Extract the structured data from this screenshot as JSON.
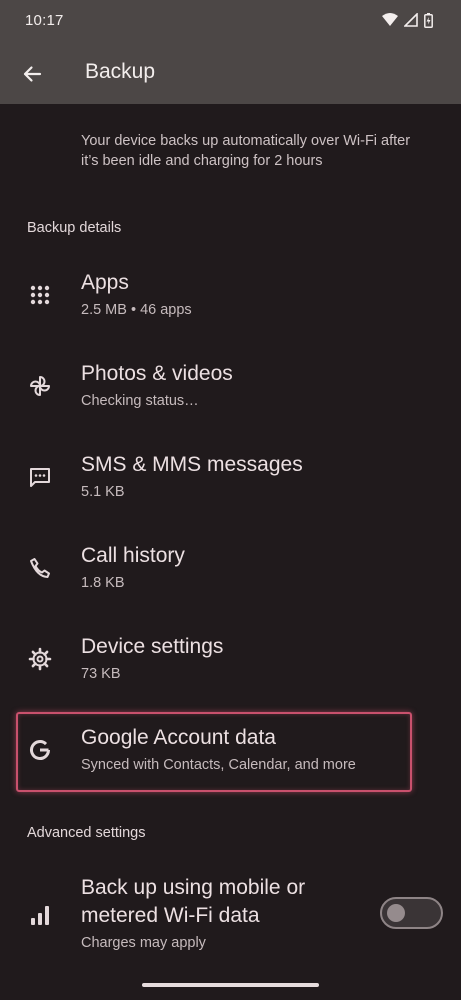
{
  "status_bar": {
    "time": "10:17"
  },
  "header": {
    "title": "Backup"
  },
  "intro_text": "Your device backs up automatically over Wi-Fi after it’s been idle and charging for 2 hours",
  "sections": {
    "backup_details": "Backup details",
    "advanced_settings": "Advanced settings"
  },
  "items": [
    {
      "title": "Apps",
      "subtitle": "2.5 MB • 46 apps",
      "icon": "apps-grid-icon"
    },
    {
      "title": "Photos & videos",
      "subtitle": "Checking status…",
      "icon": "pinwheel-icon"
    },
    {
      "title": "SMS & MMS messages",
      "subtitle": "5.1 KB",
      "icon": "message-icon"
    },
    {
      "title": "Call history",
      "subtitle": "1.8 KB",
      "icon": "phone-icon"
    },
    {
      "title": "Device settings",
      "subtitle": "73 KB",
      "icon": "gear-icon"
    },
    {
      "title": "Google Account data",
      "subtitle": "Synced with Contacts, Calendar, and more",
      "icon": "google-icon"
    }
  ],
  "mobile_data": {
    "title_line1": "Back up using mobile or",
    "title_line2": "metered Wi-Fi data",
    "subtitle": "Charges may apply",
    "icon": "signal-bars-icon",
    "enabled": false
  },
  "colors": {
    "background": "#201a1c",
    "top_bar": "#4c4746",
    "highlight": "#c9516d"
  }
}
